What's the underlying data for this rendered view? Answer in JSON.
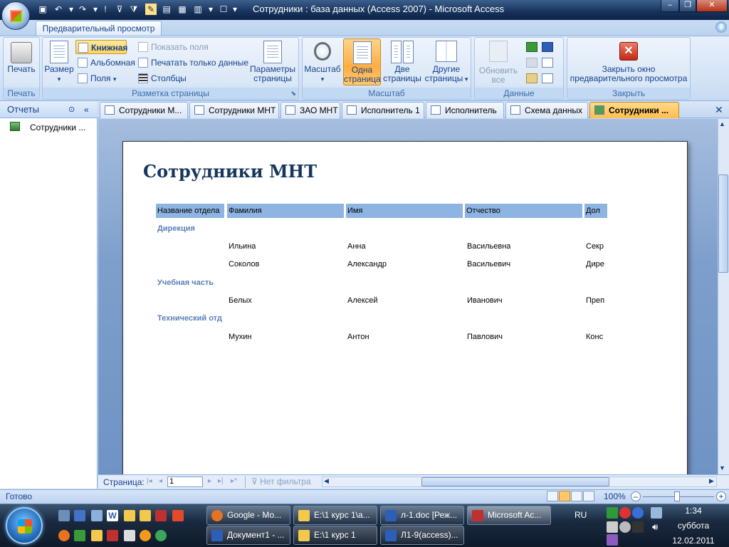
{
  "window": {
    "title": "Сотрудники : база данных (Access 2007) - Microsoft Access"
  },
  "ribbon": {
    "active_tab": "Предварительный просмотр",
    "groups": {
      "print": {
        "label": "Печать",
        "print_button": "Печать"
      },
      "layout": {
        "label": "Разметка страницы",
        "size_button": "Размер",
        "portrait": "Книжная",
        "landscape": "Альбомная",
        "margins": "Поля",
        "show_fields": "Показать поля",
        "print_data_only": "Печатать только данные",
        "columns": "Столбцы",
        "page_setup_line1": "Параметры",
        "page_setup_line2": "страницы"
      },
      "zoom": {
        "label": "Масштаб",
        "zoom_button": "Масштаб",
        "one_page_l1": "Одна",
        "one_page_l2": "страница",
        "two_pages_l1": "Две",
        "two_pages_l2": "страницы",
        "more_pages_l1": "Другие",
        "more_pages_l2": "страницы"
      },
      "data": {
        "label": "Данные",
        "refresh_l1": "Обновить",
        "refresh_l2": "все"
      },
      "close": {
        "label": "Закрыть",
        "close_l1": "Закрыть окно",
        "close_l2": "предварительного просмотра"
      }
    }
  },
  "nav": {
    "header": "Отчеты",
    "items": [
      {
        "label": "Сотрудники ..."
      }
    ]
  },
  "doc_tabs": [
    {
      "label": "Сотрудники М..."
    },
    {
      "label": "Сотрудники МНТ"
    },
    {
      "label": "ЗАО МНТ"
    },
    {
      "label": "Исполнитель 1"
    },
    {
      "label": "Исполнитель"
    },
    {
      "label": "Схема данных"
    },
    {
      "label": "Сотрудники ..."
    }
  ],
  "report": {
    "title": "Сотрудники  МНТ",
    "columns": [
      "Название отдела",
      "Фамилия",
      "Имя",
      "Отчество",
      "Дол"
    ],
    "groups": [
      {
        "name": "Дирекция",
        "rows": [
          {
            "last": "Ильина",
            "first": "Анна",
            "middle": "Васильевна",
            "pos": "Секр"
          },
          {
            "last": "Соколов",
            "first": "Александр",
            "middle": "Васильевич",
            "pos": "Дире"
          }
        ]
      },
      {
        "name": "Учебная часть",
        "rows": [
          {
            "last": "Белых",
            "first": "Алексей",
            "middle": "Иванович",
            "pos": "Преп"
          }
        ]
      },
      {
        "name": "Технический отд",
        "rows": [
          {
            "last": "Мухин",
            "first": "Антон",
            "middle": "Павлович",
            "pos": "Конс"
          }
        ]
      }
    ]
  },
  "record_bar": {
    "page_label": "Страница:",
    "page_value": "1",
    "filter": "Нет фильтра"
  },
  "status": {
    "text": "Готово",
    "zoom": "100%"
  },
  "taskbar": {
    "row1": [
      "Google - Мо...",
      "E:\\1 курс 1\\а...",
      "л-1.doc [Реж...",
      "Microsoft Ac..."
    ],
    "row2": [
      "Документ1 - ...",
      "E:\\1 курс 1",
      "Л1-9(access)..."
    ],
    "lang": "RU",
    "time": "1:34",
    "day": "суббота",
    "date": "12.02.2011"
  }
}
